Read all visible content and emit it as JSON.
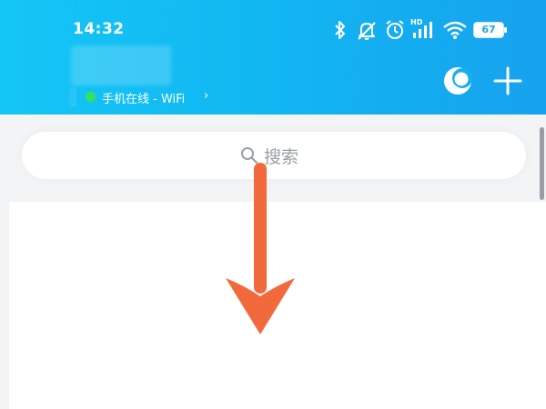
{
  "status_bar": {
    "time": "14:32",
    "icons": [
      "bluetooth-icon",
      "mute-icon",
      "alarm-icon",
      "signal-icon",
      "wifi-icon"
    ],
    "network_label": "HD",
    "battery_level": "67"
  },
  "header": {
    "online_status": "手机在线 - WiFi",
    "online_chevron": "›",
    "actions": [
      "moon-icon",
      "plus-icon"
    ]
  },
  "search": {
    "placeholder": "搜索"
  },
  "colors": {
    "header_gradient_start": "#14c6f6",
    "header_gradient_end": "#16a2ee",
    "online_dot": "#2fe26a",
    "arrow": "#f26a3b",
    "page_background": "#f3f4f6"
  }
}
